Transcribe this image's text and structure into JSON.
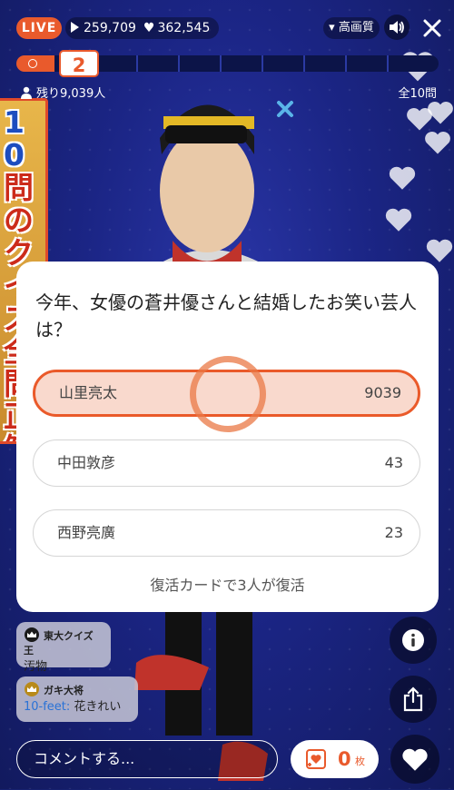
{
  "header": {
    "live_label": "LIVE",
    "viewers": "259,709",
    "likes": "362,545",
    "quality_label": "▾ 高画質"
  },
  "progress": {
    "current_question": "2",
    "remaining": "残り9,039人",
    "total_questions": "全10問"
  },
  "sign": {
    "text_num": "10",
    "text": "問のクイズ全問正解"
  },
  "quiz": {
    "question": "今年、女優の蒼井優さんと結婚したお笑い芸人は？",
    "options": [
      {
        "label": "山里亮太",
        "count": "9039",
        "selected": true
      },
      {
        "label": "中田敦彦",
        "count": "43",
        "selected": false
      },
      {
        "label": "西野亮廣",
        "count": "23",
        "selected": false
      }
    ],
    "revive_text": "復活カードで3人が復活"
  },
  "comments": [
    {
      "badge": "東大クイズ王",
      "handle": "",
      "text": "汚物"
    },
    {
      "badge": "ガキ大将",
      "handle": "10-feet:",
      "text": " 花きれい"
    }
  ],
  "footer": {
    "comment_placeholder": "コメントする...",
    "card_count": "0",
    "card_unit": "枚"
  },
  "colors": {
    "accent": "#e95a2c",
    "background": "#1b2585",
    "selected_option_bg": "#f9d9cd"
  }
}
